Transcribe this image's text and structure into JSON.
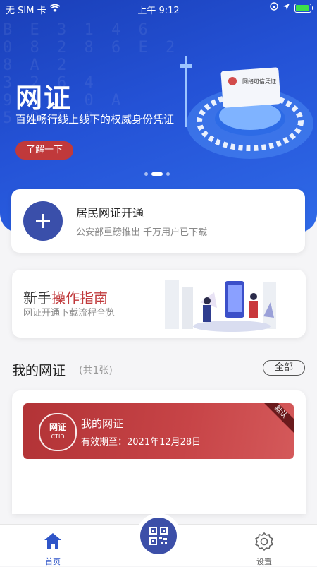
{
  "status_bar": {
    "carrier": "无 SIM 卡",
    "time": "上午 9:12"
  },
  "hero": {
    "title": "网证",
    "subtitle": "百姓畅行线上线下的权威身份凭证",
    "button_label": "了解一下",
    "card_title": "网络可信凭证",
    "deco_text": "B E 3 1 4 6\n0 8 2 8 6 E 2\n8 A 2\n3 2 6 4\n9 3 C 0 A\n5 9 6 0"
  },
  "open_service": {
    "title": "居民网证开通",
    "subtitle": "公安部重磅推出 千万用户已下载"
  },
  "guide": {
    "title_prefix": "新手",
    "title_accent": "操作指南",
    "subtitle": "网证开通下载流程全览"
  },
  "my_ids": {
    "title": "我的网证",
    "count": "(共1张)",
    "all_button": "全部",
    "card": {
      "name": "我的网证",
      "expiry": "有效期至：2021年12月28日",
      "logo_text": "网证",
      "logo_sub": "CTID",
      "badge": "默认"
    }
  },
  "tabbar": {
    "home_label": "首页",
    "settings_label": "设置"
  },
  "colors": {
    "primary_blue": "#2452d6",
    "accent_red": "#c0393b",
    "nav_blue": "#3a4faa"
  }
}
